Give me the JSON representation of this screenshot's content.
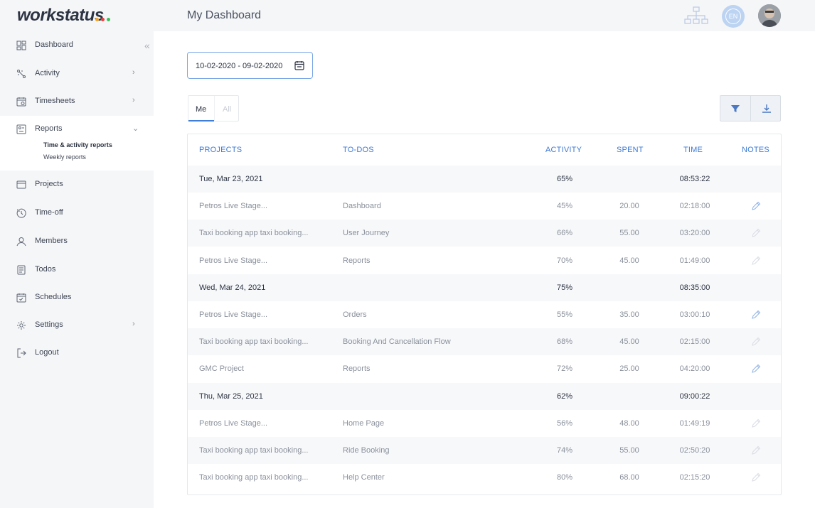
{
  "app": {
    "logo": "workstatus",
    "logo_dot_colors": [
      "#f2a32c",
      "#e8403d",
      "#3fbf5a"
    ],
    "page_title": "My Dashboard",
    "language_code": "EN",
    "accent": "#3d7ad6"
  },
  "sidebar": {
    "items": [
      {
        "label": "Dashboard",
        "icon": "dashboard-icon"
      },
      {
        "label": "Activity",
        "icon": "activity-icon",
        "has_chevron": true
      },
      {
        "label": "Timesheets",
        "icon": "timesheets-icon",
        "has_chevron": true
      },
      {
        "label": "Reports",
        "icon": "reports-icon",
        "expanded": true
      },
      {
        "label": "Projects",
        "icon": "projects-icon"
      },
      {
        "label": "Time-off",
        "icon": "time-off-icon"
      },
      {
        "label": "Members",
        "icon": "members-icon"
      },
      {
        "label": "Todos",
        "icon": "todos-icon"
      },
      {
        "label": "Schedules",
        "icon": "schedules-icon"
      },
      {
        "label": "Settings",
        "icon": "settings-icon",
        "has_chevron": true
      },
      {
        "label": "Logout",
        "icon": "logout-icon"
      }
    ],
    "reports_sub": [
      {
        "label": "Time & activity reports",
        "active": true
      },
      {
        "label": "Weekly reports"
      }
    ]
  },
  "filters": {
    "date_range": "10-02-2020 - 09-02-2020",
    "toggle_me": "Me",
    "toggle_all": "All"
  },
  "table": {
    "headers": {
      "projects": "PROJECTS",
      "todos": "TO-DOS",
      "activity": "ACTIVITY",
      "spent": "SPENT",
      "time": "TIME",
      "notes": "NOTES"
    },
    "rows": [
      {
        "type": "day",
        "project": "Tue, Mar 23, 2021",
        "todo": "",
        "activity": "65%",
        "spent": "",
        "time": "08:53:22",
        "note": ""
      },
      {
        "type": "entry",
        "project": "Petros Live Stage...",
        "todo": "Dashboard",
        "activity": "45%",
        "spent": "20.00",
        "time": "02:18:00",
        "note": "active"
      },
      {
        "type": "entry",
        "project": "Taxi booking app taxi booking...",
        "todo": "User Journey",
        "activity": "66%",
        "spent": "55.00",
        "time": "03:20:00",
        "note": "inactive"
      },
      {
        "type": "entry",
        "project": "Petros Live Stage...",
        "todo": "Reports",
        "activity": "70%",
        "spent": "45.00",
        "time": "01:49:00",
        "note": "inactive"
      },
      {
        "type": "day",
        "project": "Wed, Mar 24, 2021",
        "todo": "",
        "activity": "75%",
        "spent": "",
        "time": "08:35:00",
        "note": ""
      },
      {
        "type": "entry",
        "project": "Petros Live Stage...",
        "todo": "Orders",
        "activity": "55%",
        "spent": "35.00",
        "time": "03:00:10",
        "note": "active"
      },
      {
        "type": "entry",
        "project": "Taxi booking app taxi booking...",
        "todo": "Booking And Cancellation Flow",
        "activity": "68%",
        "spent": "45.00",
        "time": "02:15:00",
        "note": "inactive"
      },
      {
        "type": "entry",
        "project": "GMC Project",
        "todo": "Reports",
        "activity": "72%",
        "spent": "25.00",
        "time": "04:20:00",
        "note": "active"
      },
      {
        "type": "day",
        "project": "Thu, Mar 25, 2021",
        "todo": "",
        "activity": "62%",
        "spent": "",
        "time": "09:00:22",
        "note": ""
      },
      {
        "type": "entry",
        "project": "Petros Live Stage...",
        "todo": "Home Page",
        "activity": "56%",
        "spent": "48.00",
        "time": "01:49:19",
        "note": "inactive"
      },
      {
        "type": "entry",
        "project": "Taxi booking app taxi booking...",
        "todo": "Ride Booking",
        "activity": "74%",
        "spent": "55.00",
        "time": "02:50:20",
        "note": "inactive"
      },
      {
        "type": "entry",
        "project": "Taxi booking app taxi booking...",
        "todo": "Help Center",
        "activity": "80%",
        "spent": "68.00",
        "time": "02:15:20",
        "note": "inactive"
      }
    ]
  }
}
